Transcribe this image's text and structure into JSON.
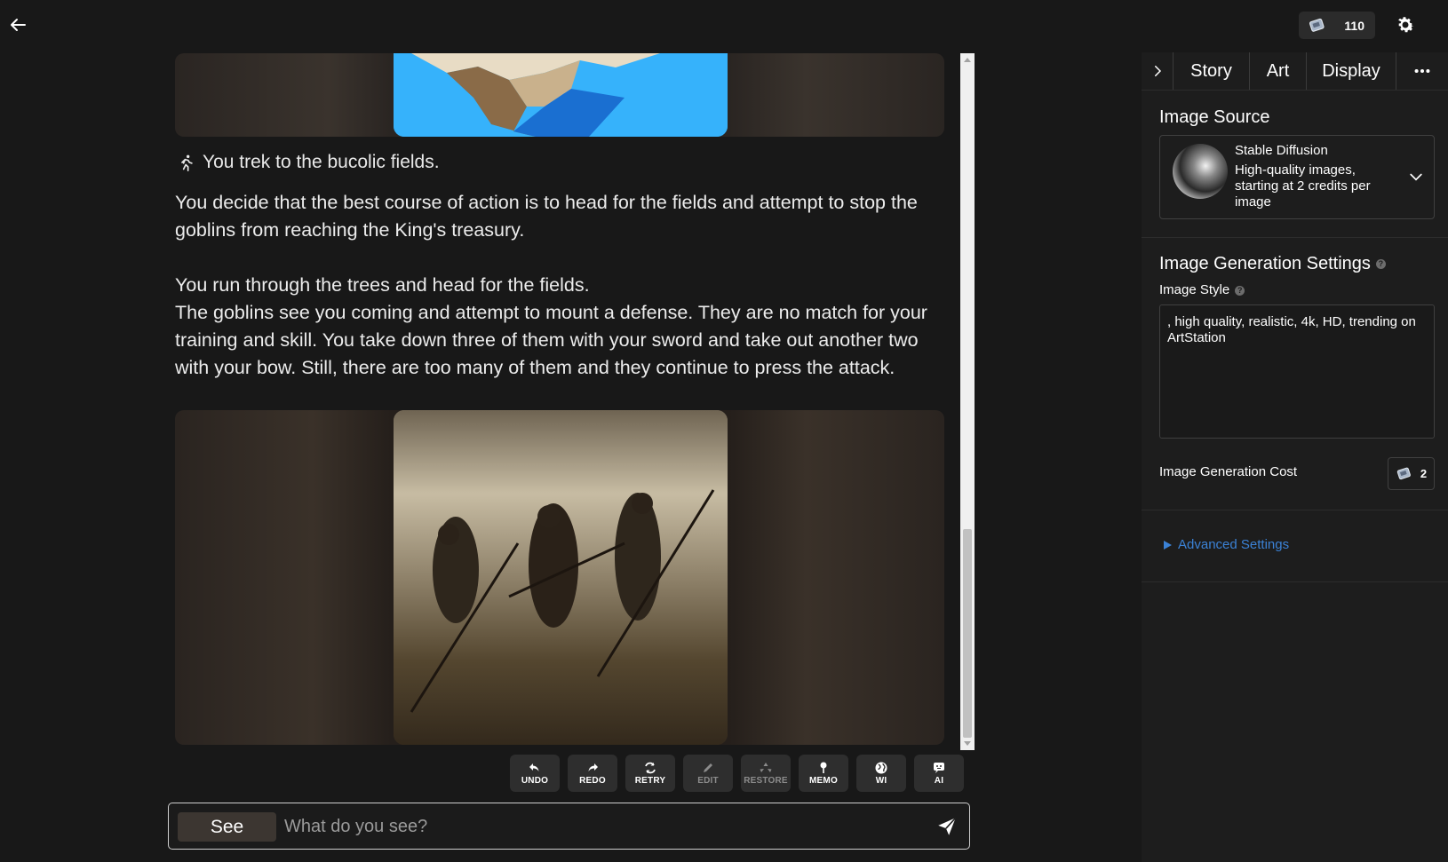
{
  "topbar": {
    "credits": "110"
  },
  "story": {
    "action_text": "You trek to the bucolic fields.",
    "paragraphs": [
      "You decide that the best course of action is to head for the fields and attempt to stop the goblins from reaching the King's treasury.",
      "You run through the trees and head for the fields.",
      "The goblins see you coming and attempt to mount a defense. They are no match for your training and skill. You take down three of them with your sword and take out another two with your bow. Still, there are too many of them and they continue to press the attack."
    ]
  },
  "toolbar": {
    "buttons": [
      {
        "label": "UNDO",
        "icon": "undo-icon"
      },
      {
        "label": "REDO",
        "icon": "redo-icon"
      },
      {
        "label": "RETRY",
        "icon": "retry-icon"
      },
      {
        "label": "EDIT",
        "icon": "edit-icon"
      },
      {
        "label": "RESTORE",
        "icon": "restore-icon"
      },
      {
        "label": "MEMO",
        "icon": "pin-icon"
      },
      {
        "label": "WI",
        "icon": "globe-icon"
      },
      {
        "label": "AI",
        "icon": "robot-icon"
      }
    ]
  },
  "input": {
    "mode": "See",
    "placeholder": "What do you see?"
  },
  "panel": {
    "tabs": [
      "Story",
      "Art",
      "Display"
    ],
    "image_source_title": "Image Source",
    "source_name": "Stable Diffusion",
    "source_desc": "High-quality images, starting at 2 credits per image",
    "gen_settings_title": "Image Generation Settings",
    "image_style_label": "Image Style",
    "image_style_value": ", high quality, realistic, 4k, HD, trending on ArtStation",
    "cost_label": "Image Generation Cost",
    "cost_value": "2",
    "advanced_label": "Advanced Settings"
  },
  "colors": {
    "background": "#181818",
    "panel": "#1d1d1d",
    "accent_link": "#3b82d6",
    "sky_blue": "#36b2fb"
  }
}
